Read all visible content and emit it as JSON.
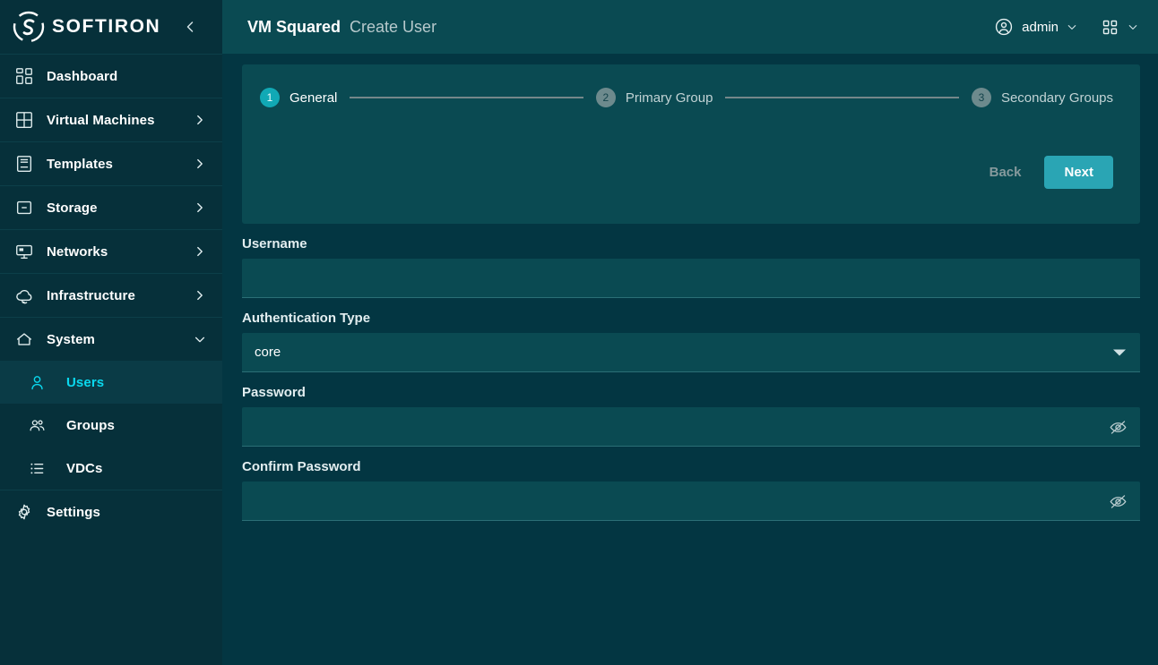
{
  "brand": {
    "name": "SOFTIRON",
    "logo_icon": "softiron-logo-icon",
    "collapse_icon": "chevron-left-icon"
  },
  "sidebar": {
    "items": [
      {
        "label": "Dashboard",
        "icon": "dashboard-icon",
        "expandable": false
      },
      {
        "label": "Virtual Machines",
        "icon": "grid-square-icon",
        "expandable": true
      },
      {
        "label": "Templates",
        "icon": "templates-icon",
        "expandable": true
      },
      {
        "label": "Storage",
        "icon": "storage-icon",
        "expandable": true
      },
      {
        "label": "Networks",
        "icon": "network-monitor-icon",
        "expandable": true
      },
      {
        "label": "Infrastructure",
        "icon": "cloud-sync-icon",
        "expandable": true
      },
      {
        "label": "System",
        "icon": "home-icon",
        "expandable": true,
        "expanded": true
      }
    ],
    "system_children": [
      {
        "label": "Users",
        "icon": "user-icon",
        "active": true
      },
      {
        "label": "Groups",
        "icon": "users-group-icon",
        "active": false
      },
      {
        "label": "VDCs",
        "icon": "list-icon",
        "active": false
      }
    ],
    "settings": {
      "label": "Settings",
      "icon": "gear-icon"
    }
  },
  "header": {
    "app_title": "VM Squared",
    "page_title": "Create User",
    "user_label": "admin",
    "user_icon": "account-circle-icon",
    "user_caret_icon": "chevron-down-icon",
    "apps_icon": "apps-grid-icon",
    "apps_caret_icon": "chevron-down-icon"
  },
  "wizard": {
    "steps": [
      {
        "number": "1",
        "label": "General",
        "state": "active"
      },
      {
        "number": "2",
        "label": "Primary Group",
        "state": "idle"
      },
      {
        "number": "3",
        "label": "Secondary Groups",
        "state": "idle"
      }
    ],
    "back_label": "Back",
    "next_label": "Next"
  },
  "form": {
    "username": {
      "label": "Username",
      "value": "",
      "placeholder": ""
    },
    "auth_type": {
      "label": "Authentication Type",
      "value": "core",
      "caret_icon": "dropdown-caret-icon"
    },
    "password": {
      "label": "Password",
      "value": "",
      "placeholder": "",
      "toggle_icon": "eye-off-icon"
    },
    "confirm_password": {
      "label": "Confirm Password",
      "value": "",
      "placeholder": "",
      "toggle_icon": "eye-off-icon"
    }
  },
  "colors": {
    "sidebar_bg": "#06303a",
    "page_bg": "#033642",
    "panel_bg": "#0a4a52",
    "accent": "#0ad8ee",
    "primary_button": "#2aa5b4",
    "step_active": "#11a9b5",
    "step_idle": "#6d8a8d"
  }
}
